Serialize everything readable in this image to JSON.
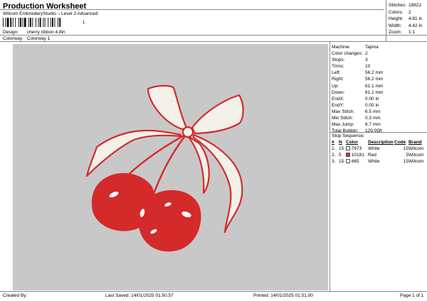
{
  "header": {
    "title": "Production Worksheet",
    "subtitle": "Wilcom EmbroideryStudio – Level 3 Advanced",
    "barcode_number": "1"
  },
  "meta": {
    "design_label": "Design:",
    "design_value": "cherry ribbon 4,8in",
    "colorway_label": "Colorway:",
    "colorway_value": "Colorway 1"
  },
  "top_stats": [
    {
      "k": "Stitches:",
      "v": "18821"
    },
    {
      "k": "Colors:",
      "v": "2"
    },
    {
      "k": "Height:",
      "v": "4.81 in"
    },
    {
      "k": "Width:",
      "v": "4.42 in"
    },
    {
      "k": "Zoom:",
      "v": "1:1"
    }
  ],
  "info": [
    {
      "k": "Machine:",
      "v": "Tajima"
    },
    {
      "k": "Color changes:",
      "v": "2"
    },
    {
      "k": "Stops:",
      "v": "3"
    },
    {
      "k": "Trims:",
      "v": "10"
    },
    {
      "k": "Left:",
      "v": "56.2 mm"
    },
    {
      "k": "Right:",
      "v": "56.2 mm"
    },
    {
      "k": "Up:",
      "v": "61.1 mm"
    },
    {
      "k": "Down:",
      "v": "61.1 mm"
    },
    {
      "k": "EndX:",
      "v": "0.00 in"
    },
    {
      "k": "EndY:",
      "v": "0.00 in"
    },
    {
      "k": "Max Stitch:",
      "v": "6.5 mm"
    },
    {
      "k": "Min Stitch:",
      "v": "0.3 mm"
    },
    {
      "k": "Max Jump:",
      "v": "6.7 mm"
    },
    {
      "k": "Total Bobbin:",
      "v": "129.05ft"
    }
  ],
  "stops": {
    "heading": "Stop Sequence:",
    "columns": [
      "#",
      "N",
      "Color",
      "Description",
      "Code",
      "Brand"
    ],
    "rows": [
      {
        "num": "1.",
        "n": "15",
        "swatch": "#ffffff",
        "color": "7973",
        "desc": "White",
        "code": "15",
        "brand": "Wilcom"
      },
      {
        "num": "2.",
        "n": "5",
        "swatch": "#d42a2a",
        "color": "10181",
        "desc": "Red",
        "code": "5",
        "brand": "Wilcom"
      },
      {
        "num": "3.",
        "n": "15",
        "swatch": "#ffffff",
        "color": "665",
        "desc": "White",
        "code": "15",
        "brand": "Wilcom"
      }
    ]
  },
  "footer": {
    "created_by": "Created By:",
    "last_saved": "Last Saved: 14/01/2025 01.50.57",
    "printed": "Printed: 14/01/2025 01.51.00",
    "page": "Page 1 of 1"
  },
  "colors": {
    "canvas_bg": "#c8c8c8",
    "cherry_red": "#d42a2a",
    "ribbon_fill": "#f1f1ea"
  }
}
